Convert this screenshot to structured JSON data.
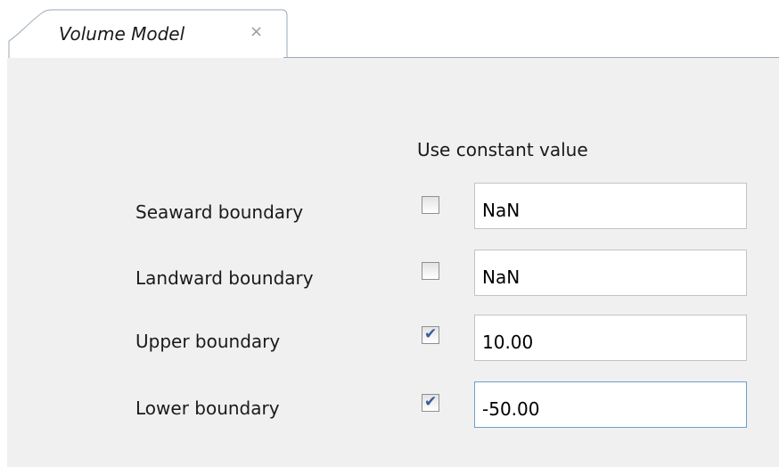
{
  "tab": {
    "title": "Volume Model",
    "close_glyph": "×"
  },
  "panel": {
    "column_header": "Use constant value",
    "rows": [
      {
        "label": "Seaward boundary",
        "checked": false,
        "value": "NaN"
      },
      {
        "label": "Landward boundary",
        "checked": false,
        "value": "NaN"
      },
      {
        "label": "Upper boundary",
        "checked": true,
        "value": "10.00"
      },
      {
        "label": "Lower boundary",
        "checked": true,
        "value": "-50.00"
      }
    ]
  },
  "colors": {
    "panel_background": "#f0f0f0",
    "tab_border": "#9aa8b8",
    "check_mark": "#3a5a9a",
    "focused_border": "#6e9ec8"
  },
  "icons": {
    "close": "close-icon",
    "check": "checkmark-icon"
  }
}
